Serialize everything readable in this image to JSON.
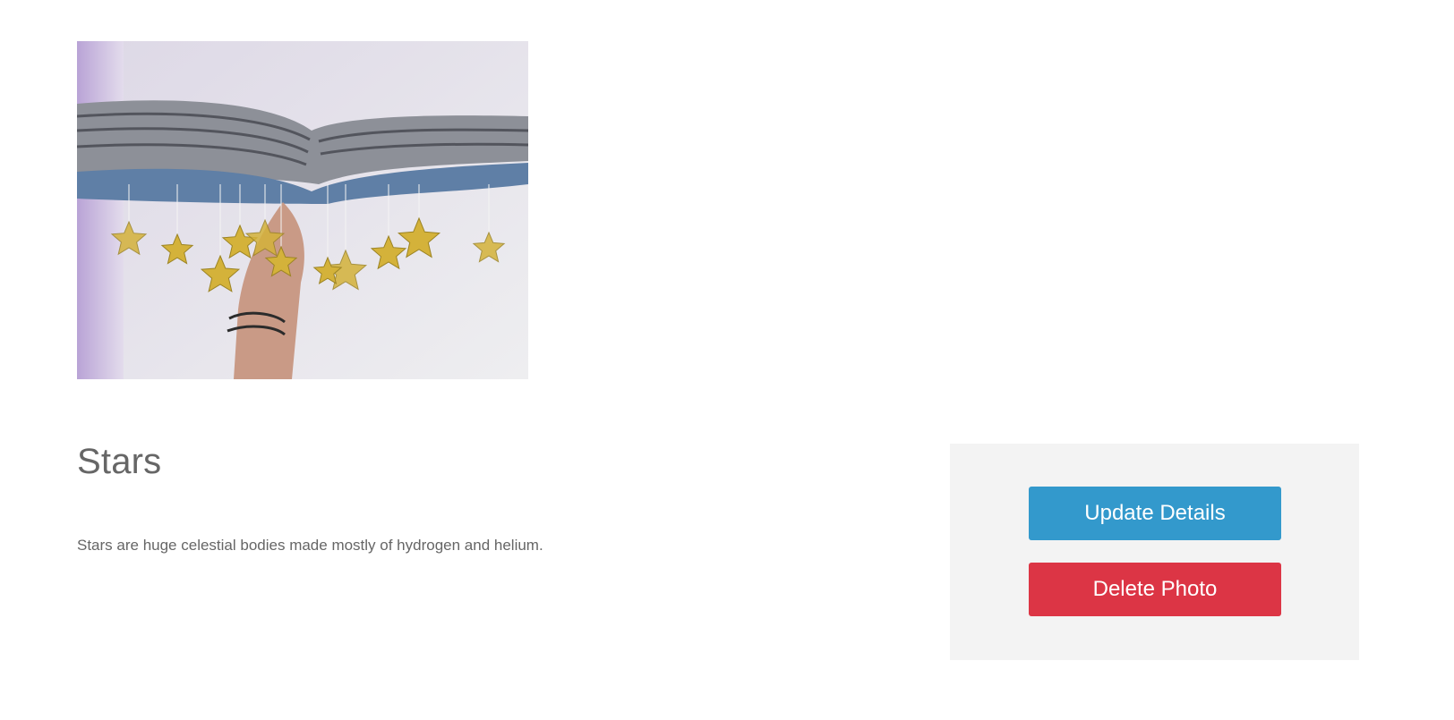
{
  "photo": {
    "subject": "hanging paper stars under an open book",
    "colors": {
      "wall": "#e8e6ec",
      "book_pages": "#8a8e96",
      "book_cover": "#5f7fa6",
      "star": "#d4b23a",
      "hand": "#c99a86"
    }
  },
  "details": {
    "title": "Stars",
    "description": "Stars are huge celestial bodies made mostly of hydrogen and helium."
  },
  "actions": {
    "update_label": "Update Details",
    "delete_label": "Delete Photo",
    "update_color": "#3399cc",
    "delete_color": "#dc3545",
    "panel_color": "#f3f3f3"
  }
}
